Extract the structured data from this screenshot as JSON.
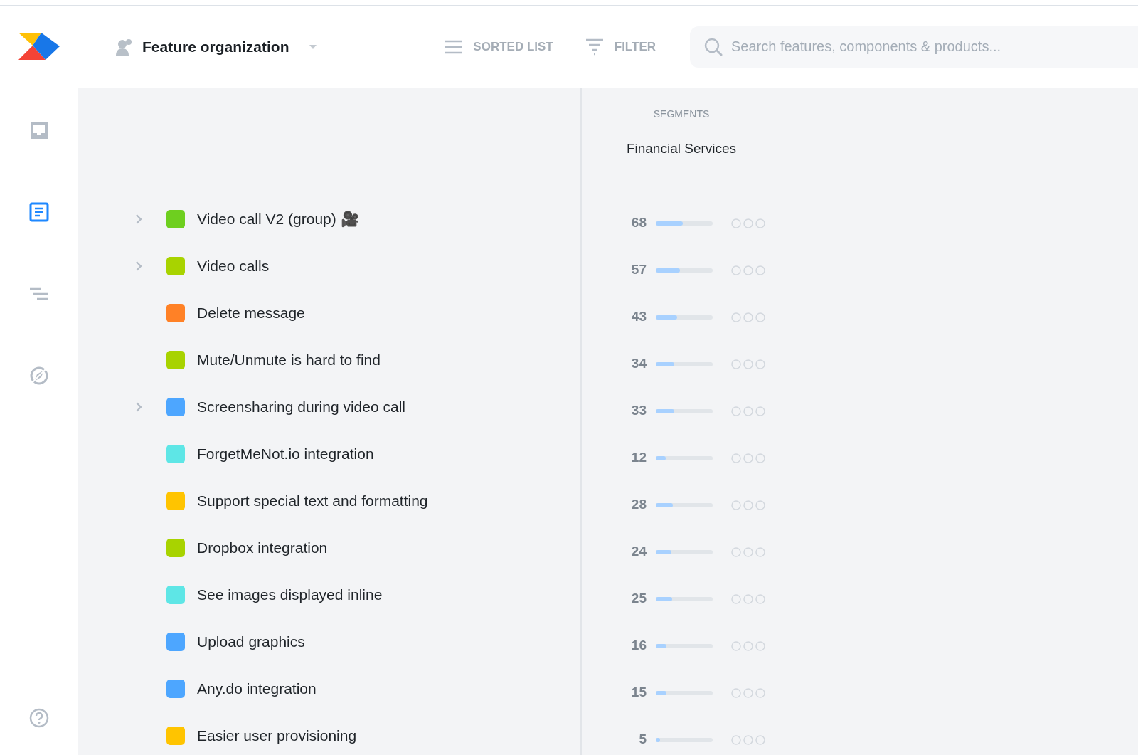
{
  "header": {
    "workspace": "Feature organization",
    "view_button": "SORTED LIST",
    "filter_button": "FILTER",
    "search": {
      "placeholder": "Search features, components & products..."
    }
  },
  "sidebar": {
    "items": [
      {
        "kind": "inbox",
        "selected": false
      },
      {
        "kind": "document",
        "selected": true
      },
      {
        "kind": "roadmap",
        "selected": false
      },
      {
        "kind": "compass",
        "selected": false
      }
    ],
    "help_selected": false
  },
  "segments": {
    "heading": "SEGMENTS",
    "name": "Financial Services"
  },
  "features": [
    {
      "name": "Video call V2 (group) 🎥",
      "color": "#6ecf1f",
      "expandable": true,
      "score": "68",
      "level": 0.48
    },
    {
      "name": "Video calls",
      "color": "#a8d300",
      "expandable": true,
      "score": "57",
      "level": 0.43
    },
    {
      "name": "Delete message",
      "color": "#ff8126",
      "expandable": false,
      "score": "43",
      "level": 0.37
    },
    {
      "name": "Mute/Unmute is hard to find",
      "color": "#a8d300",
      "expandable": false,
      "score": "34",
      "level": 0.33
    },
    {
      "name": "Screensharing during video call",
      "color": "#4da6ff",
      "expandable": true,
      "score": "33",
      "level": 0.32
    },
    {
      "name": "ForgetMeNot.io integration",
      "color": "#5ee6e6",
      "expandable": false,
      "score": "12",
      "level": 0.17
    },
    {
      "name": "Support special text and formatting",
      "color": "#ffc400",
      "expandable": false,
      "score": "28",
      "level": 0.3
    },
    {
      "name": "Dropbox integration",
      "color": "#a8d300",
      "expandable": false,
      "score": "24",
      "level": 0.27
    },
    {
      "name": "See images displayed inline",
      "color": "#5ee6e6",
      "expandable": false,
      "score": "25",
      "level": 0.29
    },
    {
      "name": "Upload graphics",
      "color": "#4da6ff",
      "expandable": false,
      "score": "16",
      "level": 0.19
    },
    {
      "name": "Any.do integration",
      "color": "#4da6ff",
      "expandable": false,
      "score": "15",
      "level": 0.19
    },
    {
      "name": "Easier user provisioning",
      "color": "#ffc400",
      "expandable": false,
      "score": "5",
      "level": 0.07
    }
  ]
}
